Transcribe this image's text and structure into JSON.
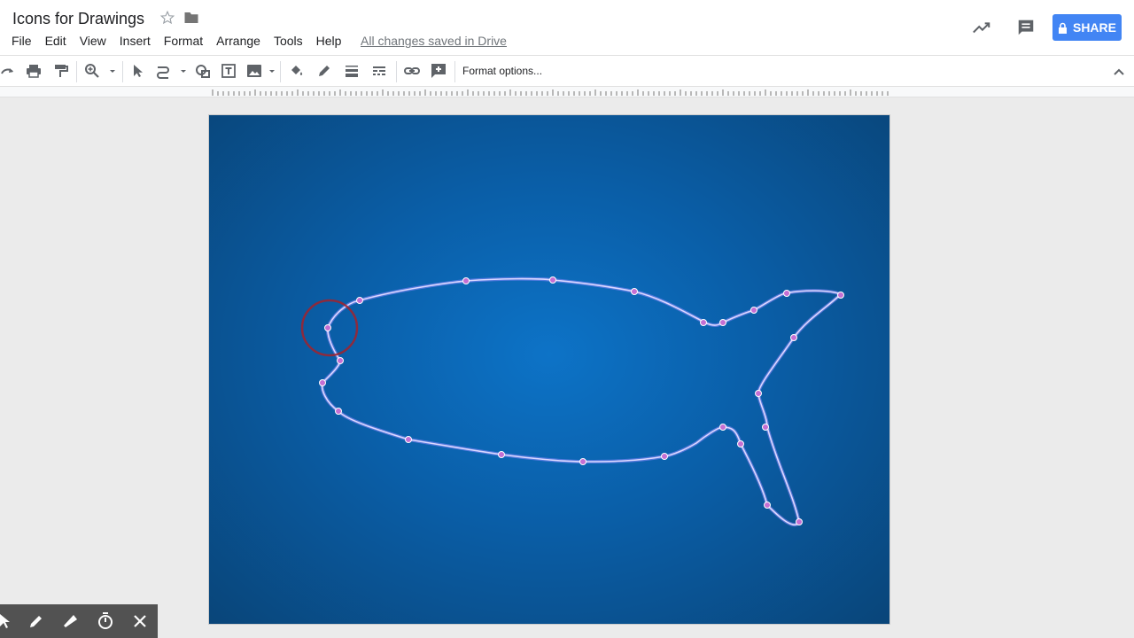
{
  "app": {
    "doc_title": "Icons for Drawings",
    "menu": [
      "File",
      "Edit",
      "View",
      "Insert",
      "Format",
      "Arrange",
      "Tools",
      "Help"
    ],
    "saved_status": "All changes saved in Drive",
    "share_label": "SHARE"
  },
  "toolbar": {
    "format_options": "Format options..."
  },
  "colors": {
    "accent": "#4285f4",
    "canvas_center": "#0d73c7",
    "canvas_edge": "#094579",
    "path_stroke": "#c9c4ff",
    "point_fill": "#c46fd3",
    "annotation_circle": "#a3222b"
  },
  "icons": [
    "star-icon",
    "folder-icon",
    "trend-icon",
    "comment-icon",
    "lock-icon",
    "redo-icon",
    "print-icon",
    "paint-format-icon",
    "zoom-icon",
    "select-icon",
    "line-icon",
    "shape-icon",
    "textbox-icon",
    "image-icon",
    "fill-color-icon",
    "line-color-icon",
    "line-weight-icon",
    "line-dash-icon",
    "link-icon",
    "add-comment-icon",
    "collapse-icon",
    "pointer-icon",
    "pen-icon",
    "highlighter-icon",
    "timer-icon",
    "close-icon"
  ]
}
